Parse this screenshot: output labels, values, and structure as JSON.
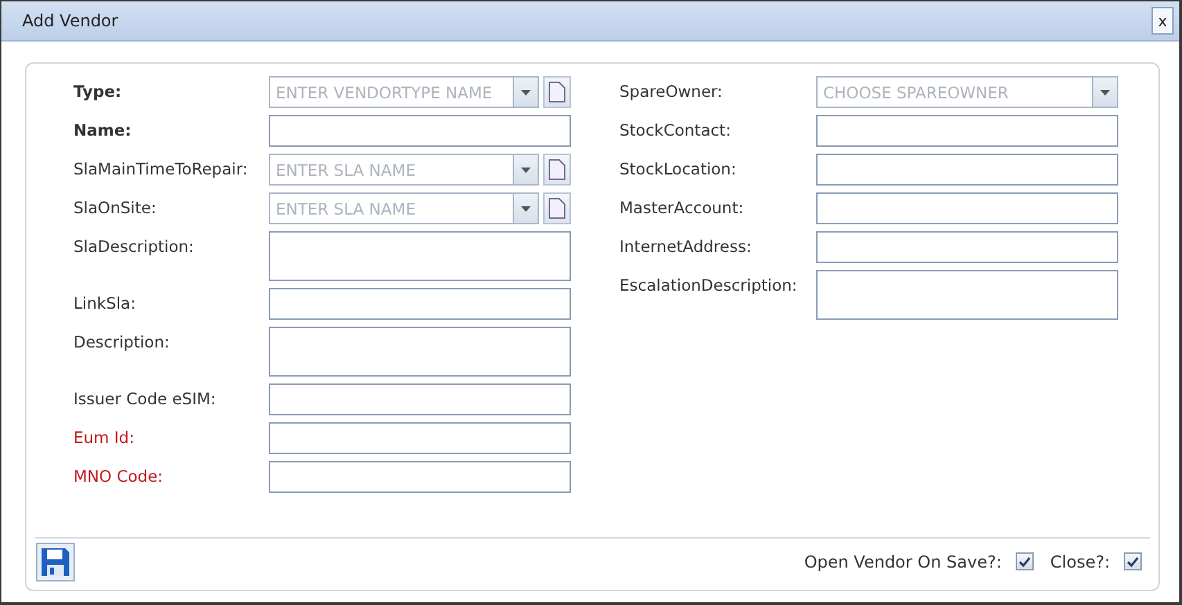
{
  "window": {
    "title": "Add Vendor",
    "close": "x"
  },
  "left_fields": [
    {
      "label": "Type:",
      "required": true,
      "warning": false,
      "kind": "combo_new",
      "placeholder": "ENTER VENDORTYPE NAME"
    },
    {
      "label": "Name:",
      "required": true,
      "warning": false,
      "kind": "text"
    },
    {
      "label": "SlaMainTimeToRepair:",
      "required": false,
      "warning": false,
      "kind": "combo_new",
      "placeholder": "ENTER SLA NAME"
    },
    {
      "label": "SlaOnSite:",
      "required": false,
      "warning": false,
      "kind": "combo_new",
      "placeholder": "ENTER SLA NAME"
    },
    {
      "label": "SlaDescription:",
      "required": false,
      "warning": false,
      "kind": "textarea"
    },
    {
      "label": "LinkSla:",
      "required": false,
      "warning": false,
      "kind": "text"
    },
    {
      "label": "Description:",
      "required": false,
      "warning": false,
      "kind": "textarea"
    },
    {
      "label": "Issuer Code eSIM:",
      "required": false,
      "warning": false,
      "kind": "text"
    },
    {
      "label": "Eum Id:",
      "required": false,
      "warning": true,
      "kind": "text"
    },
    {
      "label": "MNO Code:",
      "required": false,
      "warning": true,
      "kind": "text"
    }
  ],
  "right_fields": [
    {
      "label": "SpareOwner:",
      "required": false,
      "warning": false,
      "kind": "combo",
      "placeholder": "CHOOSE SPAREOWNER"
    },
    {
      "label": "StockContact:",
      "required": false,
      "warning": false,
      "kind": "text"
    },
    {
      "label": "StockLocation:",
      "required": false,
      "warning": false,
      "kind": "text"
    },
    {
      "label": "MasterAccount:",
      "required": false,
      "warning": false,
      "kind": "text"
    },
    {
      "label": "InternetAddress:",
      "required": false,
      "warning": false,
      "kind": "text"
    },
    {
      "label": "EscalationDescription:",
      "required": false,
      "warning": false,
      "kind": "textarea"
    }
  ],
  "options": [
    {
      "label": "Open Vendor On Save?:",
      "checked": true
    },
    {
      "label": "Close?:",
      "checked": true
    }
  ]
}
